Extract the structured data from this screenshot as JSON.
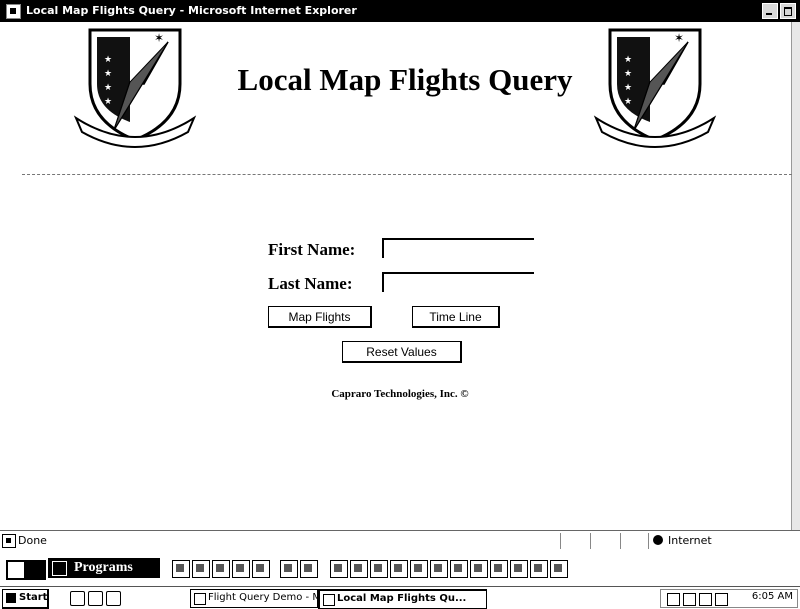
{
  "window": {
    "title": "Local Map Flights Query - Microsoft Internet Explorer"
  },
  "page": {
    "title": "Local Map Flights Query",
    "form": {
      "first_name_label": "First Name:",
      "first_name_value": "",
      "last_name_label": "Last Name:",
      "last_name_value": "",
      "map_flights_button": "Map Flights",
      "time_line_button": "Time Line",
      "reset_button": "Reset Values"
    },
    "footer": "Capraro Technologies, Inc. ©"
  },
  "statusbar": {
    "status": "Done",
    "zone": "Internet"
  },
  "office_bar": {
    "programs_label": "Programs"
  },
  "taskbar": {
    "start_label": "Start",
    "tasks": [
      {
        "label": "Flight Query Demo - Micros..."
      },
      {
        "label": "Local Map Flights Qu..."
      }
    ],
    "clock": "6:05 AM"
  }
}
